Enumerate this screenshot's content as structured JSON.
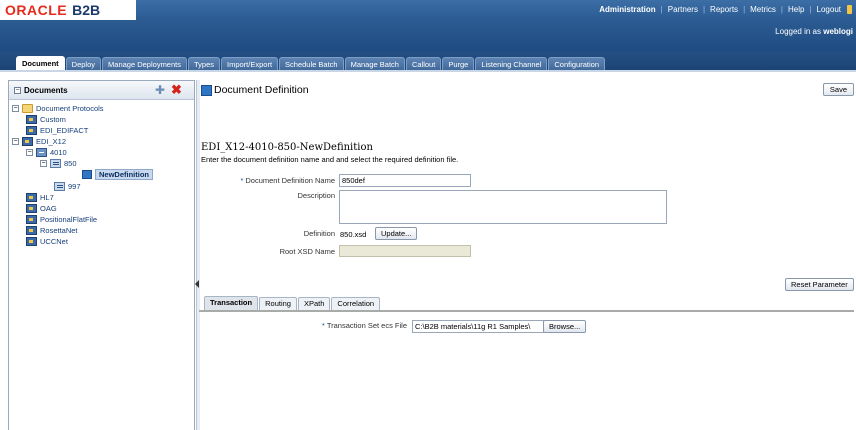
{
  "header": {
    "logo_oracle": "ORACLE",
    "logo_product": "B2B",
    "nav": [
      "Administration",
      "Partners",
      "Reports",
      "Metrics",
      "Help",
      "Logout"
    ],
    "logged_in_prefix": "Logged in as ",
    "logged_in_user": "weblogi"
  },
  "tabs": [
    "Document",
    "Deploy",
    "Manage Deployments",
    "Types",
    "Import/Export",
    "Schedule Batch",
    "Manage Batch",
    "Callout",
    "Purge",
    "Listening Channel",
    "Configuration"
  ],
  "active_tab": "Document",
  "left_panel": {
    "title": "Documents",
    "tree": {
      "root": "Document Protocols",
      "custom": "Custom",
      "edifact": "EDI_EDIFACT",
      "x12": "EDI_X12",
      "v4010": "4010",
      "t850": "850",
      "new_def": "NewDefinition",
      "t997": "997",
      "hl7": "HL7",
      "oag": "OAG",
      "positional": "PositionalFlatFile",
      "rosettanet": "RosettaNet",
      "uccnet": "UCCNet"
    }
  },
  "main": {
    "title": "Document Definition",
    "save_label": "Save",
    "heading": "EDI_X12-4010-850-NewDefinition",
    "instruction": "Enter the document definition name and and select the required definition file.",
    "labels": {
      "name": "Document Definition Name",
      "description": "Description",
      "definition": "Definition",
      "root_xsd": "Root XSD Name"
    },
    "values": {
      "name": "850def",
      "description": "",
      "definition_file": "850.xsd",
      "root_xsd": ""
    },
    "update_label": "Update...",
    "reset_label": "Reset Parameter",
    "sub_tabs": [
      "Transaction",
      "Routing",
      "XPath",
      "Correlation"
    ],
    "transaction": {
      "label": "Transaction Set ecs File",
      "path": "C:\\B2B materials\\11g R1 Samples\\",
      "browse_label": "Browse..."
    }
  }
}
